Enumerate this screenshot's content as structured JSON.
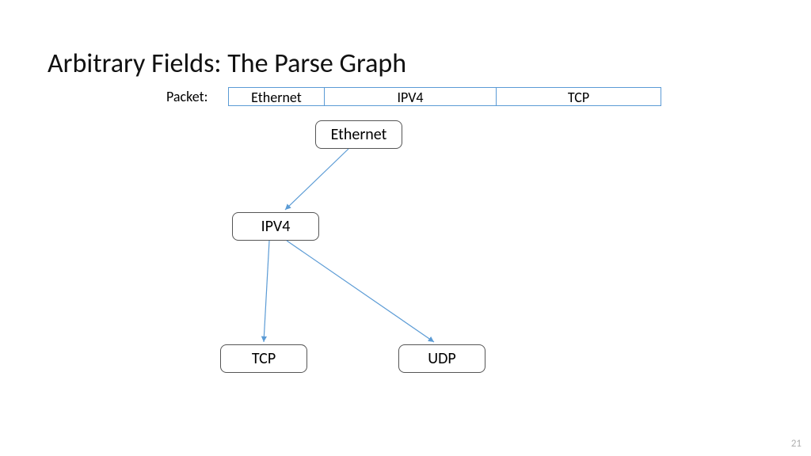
{
  "title": "Arbitrary Fields: The Parse Graph",
  "packet_label": "Packet:",
  "packet": {
    "cells": [
      "Ethernet",
      "IPV4",
      "TCP"
    ]
  },
  "nodes": {
    "ethernet": "Ethernet",
    "ipv4": "IPV4",
    "tcp": "TCP",
    "udp": "UDP"
  },
  "page_number": "21",
  "edges": [
    {
      "from": "ethernet",
      "to": "ipv4"
    },
    {
      "from": "ipv4",
      "to": "tcp"
    },
    {
      "from": "ipv4",
      "to": "udp"
    }
  ],
  "colors": {
    "arrow": "#5b9bd5",
    "cell_border": "#5b9bd5",
    "node_border": "#555555"
  }
}
